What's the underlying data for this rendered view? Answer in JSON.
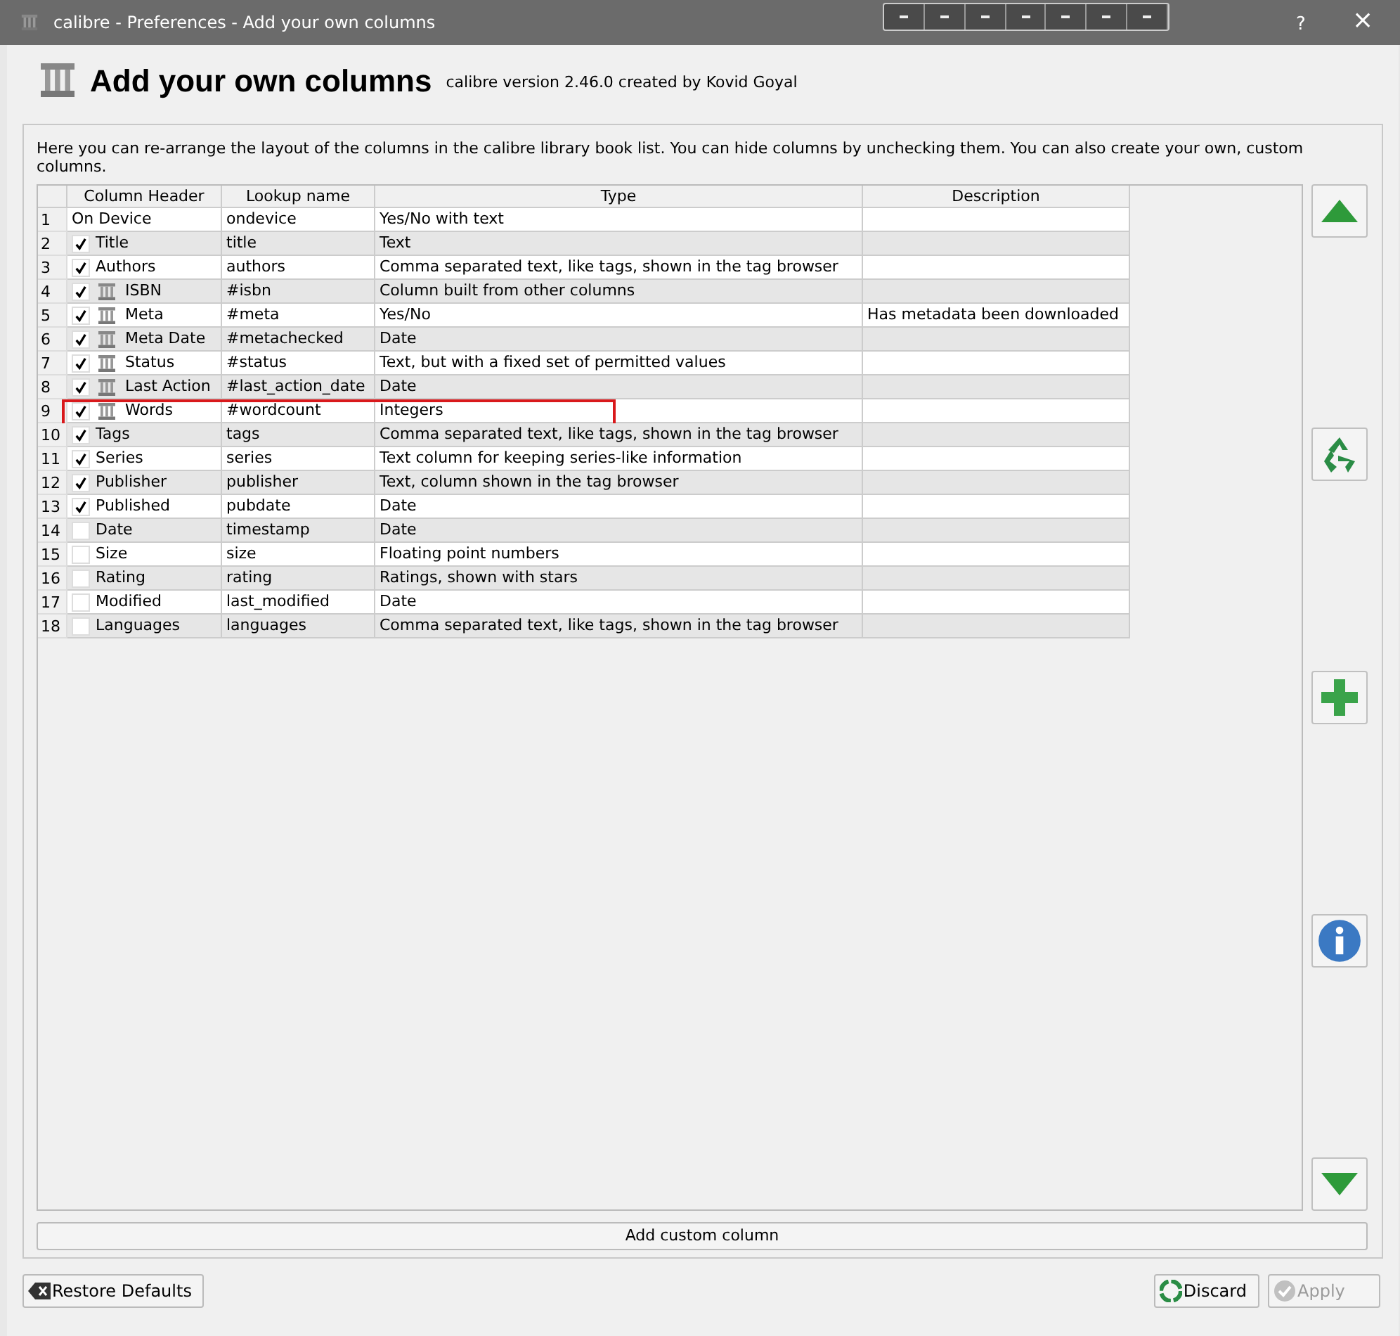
{
  "window": {
    "title": "calibre - Preferences - Add your own columns",
    "help": "?",
    "close": "×"
  },
  "header": {
    "title": "Add your own columns",
    "subtitle": "calibre version 2.46.0 created by Kovid Goyal"
  },
  "intro": "Here you can re-arrange the layout of the columns in the calibre library book list. You can hide columns by unchecking them. You can also create your own, custom columns.",
  "table": {
    "columns": [
      "Column Header",
      "Lookup name",
      "Type",
      "Description"
    ],
    "rows": [
      {
        "number": "1",
        "kind": "fixed",
        "custom": false,
        "highlighted": false,
        "header": "On Device",
        "lookup": "ondevice",
        "type": "Yes/No with text",
        "description": ""
      },
      {
        "number": "2",
        "kind": "toggle",
        "checked": true,
        "custom": false,
        "highlighted": false,
        "header": "Title",
        "lookup": "title",
        "type": "Text",
        "description": ""
      },
      {
        "number": "3",
        "kind": "toggle",
        "checked": true,
        "custom": false,
        "highlighted": false,
        "header": "Authors",
        "lookup": "authors",
        "type": "Comma separated text, like tags, shown in the tag browser",
        "description": ""
      },
      {
        "number": "4",
        "kind": "toggle",
        "checked": true,
        "custom": true,
        "highlighted": false,
        "header": "ISBN",
        "lookup": "#isbn",
        "type": "Column built from other columns",
        "description": ""
      },
      {
        "number": "5",
        "kind": "toggle",
        "checked": true,
        "custom": true,
        "highlighted": false,
        "header": "Meta",
        "lookup": "#meta",
        "type": "Yes/No",
        "description": "Has metadata been downloaded"
      },
      {
        "number": "6",
        "kind": "toggle",
        "checked": true,
        "custom": true,
        "highlighted": false,
        "header": "Meta Date",
        "lookup": "#metachecked",
        "type": "Date",
        "description": ""
      },
      {
        "number": "7",
        "kind": "toggle",
        "checked": true,
        "custom": true,
        "highlighted": false,
        "header": "Status",
        "lookup": "#status",
        "type": "Text, but with a fixed set of permitted values",
        "description": ""
      },
      {
        "number": "8",
        "kind": "toggle",
        "checked": true,
        "custom": true,
        "highlighted": false,
        "header": "Last Action",
        "lookup": "#last_action_date",
        "type": "Date",
        "description": ""
      },
      {
        "number": "9",
        "kind": "toggle",
        "checked": true,
        "custom": true,
        "highlighted": true,
        "header": "Words",
        "lookup": "#wordcount",
        "type": "Integers",
        "description": ""
      },
      {
        "number": "10",
        "kind": "toggle",
        "checked": true,
        "custom": false,
        "highlighted": false,
        "header": "Tags",
        "lookup": "tags",
        "type": "Comma separated text, like tags, shown in the tag browser",
        "description": ""
      },
      {
        "number": "11",
        "kind": "toggle",
        "checked": true,
        "custom": false,
        "highlighted": false,
        "header": "Series",
        "lookup": "series",
        "type": "Text column for keeping series-like information",
        "description": ""
      },
      {
        "number": "12",
        "kind": "toggle",
        "checked": true,
        "custom": false,
        "highlighted": false,
        "header": "Publisher",
        "lookup": "publisher",
        "type": "Text, column shown in the tag browser",
        "description": ""
      },
      {
        "number": "13",
        "kind": "toggle",
        "checked": true,
        "custom": false,
        "highlighted": false,
        "header": "Published",
        "lookup": "pubdate",
        "type": "Date",
        "description": ""
      },
      {
        "number": "14",
        "kind": "toggle",
        "checked": false,
        "custom": false,
        "highlighted": false,
        "header": "Date",
        "lookup": "timestamp",
        "type": "Date",
        "description": ""
      },
      {
        "number": "15",
        "kind": "toggle",
        "checked": false,
        "custom": false,
        "highlighted": false,
        "header": "Size",
        "lookup": "size",
        "type": "Floating point numbers",
        "description": ""
      },
      {
        "number": "16",
        "kind": "toggle",
        "checked": false,
        "custom": false,
        "highlighted": false,
        "header": "Rating",
        "lookup": "rating",
        "type": "Ratings, shown with stars",
        "description": ""
      },
      {
        "number": "17",
        "kind": "toggle",
        "checked": false,
        "custom": false,
        "highlighted": false,
        "header": "Modified",
        "lookup": "last_modified",
        "type": "Date",
        "description": ""
      },
      {
        "number": "18",
        "kind": "toggle",
        "checked": false,
        "custom": false,
        "highlighted": false,
        "header": "Languages",
        "lookup": "languages",
        "type": "Comma separated text, like tags, shown in the tag browser",
        "description": ""
      }
    ]
  },
  "side_buttons": [
    {
      "kind": "up"
    },
    {
      "kind": "recycle"
    },
    {
      "kind": "add"
    },
    {
      "kind": "info"
    },
    {
      "kind": "down"
    }
  ],
  "add_button": "Add custom column",
  "buttons": [
    {
      "label": "Restore Defaults",
      "kind": "restore",
      "disabled": false
    },
    {
      "label": "Discard",
      "kind": "discard",
      "disabled": false
    },
    {
      "label": "Apply",
      "kind": "apply",
      "disabled": true
    }
  ]
}
